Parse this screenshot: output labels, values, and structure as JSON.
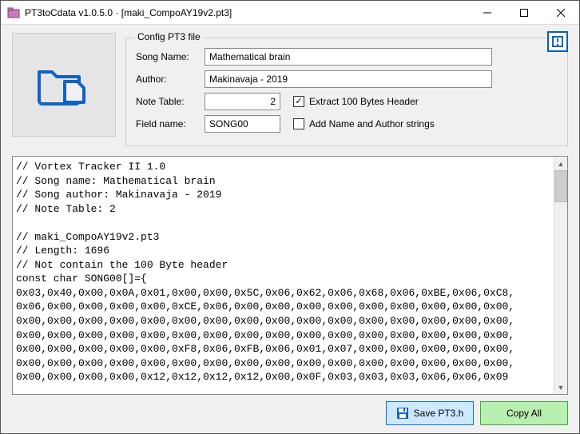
{
  "window": {
    "title": "PT3toCdata v1.0.5.0 · [maki_CompoAY19v2.pt3]"
  },
  "fieldset": {
    "legend": "Config PT3 file",
    "song_label": "Song Name:",
    "song_value": "Mathematical brain",
    "author_label": "Author:",
    "author_value": "Makinavaja - 2019",
    "notetable_label": "Note Table:",
    "notetable_value": "2",
    "fieldname_label": "Field name:",
    "fieldname_value": "SONG00",
    "cb_extract_label": "Extract 100 Bytes Header",
    "cb_extract_checked": "✓",
    "cb_addname_label": "Add Name and Author strings"
  },
  "buttons": {
    "save": "Save PT3.h",
    "copy": "Copy All"
  },
  "code": "// Vortex Tracker II 1.0\n// Song name: Mathematical brain\n// Song author: Makinavaja - 2019\n// Note Table: 2\n\n// maki_CompoAY19v2.pt3\n// Length: 1696\n// Not contain the 100 Byte header\nconst char SONG00[]={\n0x03,0x40,0x00,0x0A,0x01,0x00,0x00,0x5C,0x06,0x62,0x06,0x68,0x06,0xBE,0x06,0xC8,\n0x06,0x00,0x00,0x00,0x00,0xCE,0x06,0x00,0x00,0x00,0x00,0x00,0x00,0x00,0x00,0x00,\n0x00,0x00,0x00,0x00,0x00,0x00,0x00,0x00,0x00,0x00,0x00,0x00,0x00,0x00,0x00,0x00,\n0x00,0x00,0x00,0x00,0x00,0x00,0x00,0x00,0x00,0x00,0x00,0x00,0x00,0x00,0x00,0x00,\n0x00,0x00,0x00,0x00,0x00,0xF8,0x06,0xFB,0x06,0x01,0x07,0x00,0x00,0x00,0x00,0x00,\n0x00,0x00,0x00,0x00,0x00,0x00,0x00,0x00,0x00,0x00,0x00,0x00,0x00,0x00,0x00,0x00,\n0x00,0x00,0x00,0x00,0x12,0x12,0x12,0x12,0x00,0x0F,0x03,0x03,0x03,0x06,0x06,0x09"
}
